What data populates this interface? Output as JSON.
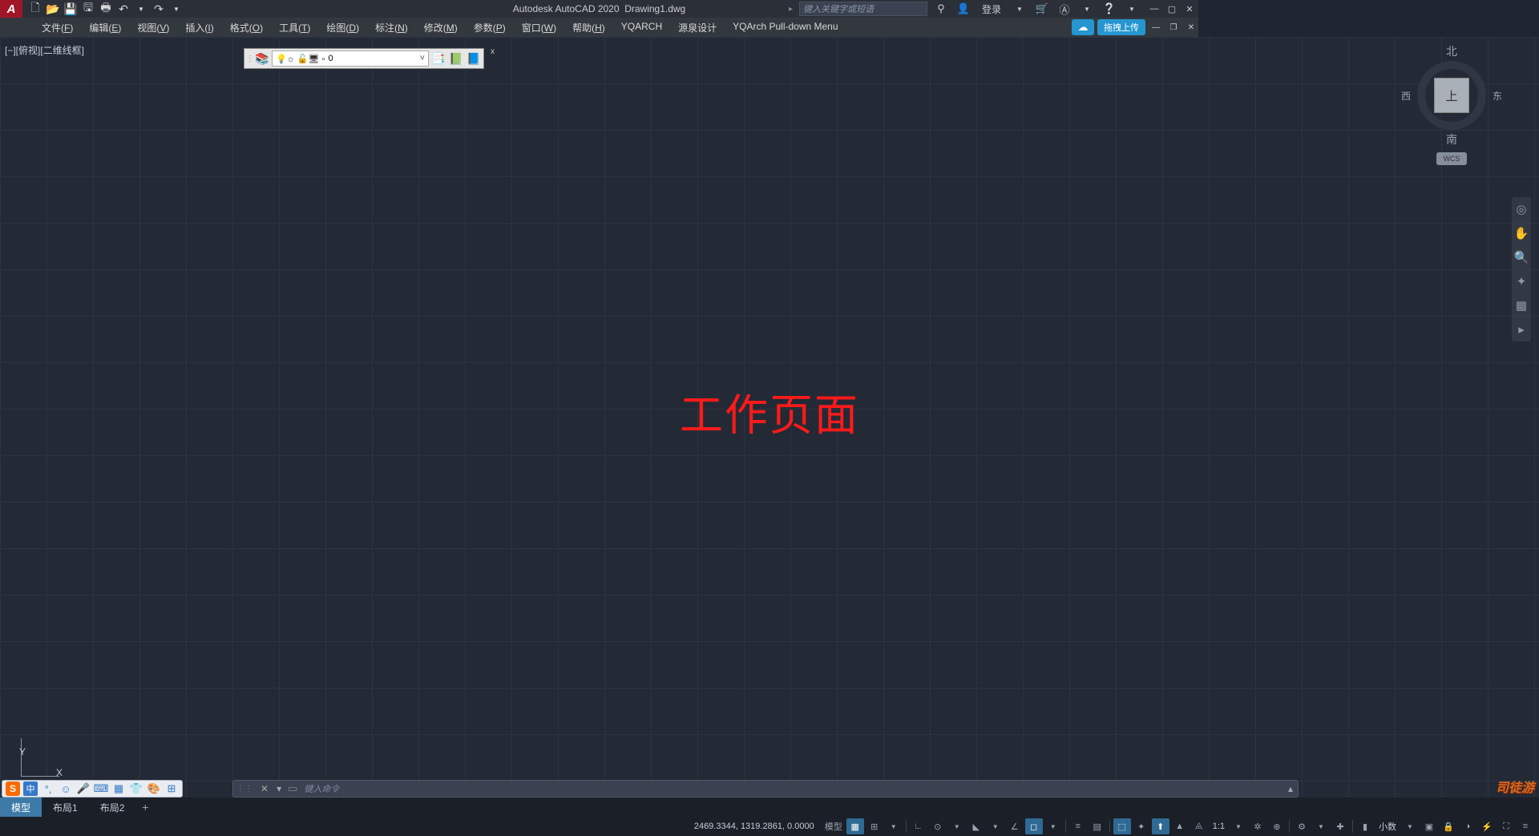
{
  "title": {
    "app": "Autodesk AutoCAD 2020",
    "file": "Drawing1.dwg"
  },
  "search": {
    "placeholder": "键入关键字或短语"
  },
  "login": "登录",
  "upload": "拖拽上传",
  "menubar": [
    {
      "label": "文件",
      "key": "F"
    },
    {
      "label": "编辑",
      "key": "E"
    },
    {
      "label": "视图",
      "key": "V"
    },
    {
      "label": "插入",
      "key": "I"
    },
    {
      "label": "格式",
      "key": "O"
    },
    {
      "label": "工具",
      "key": "T"
    },
    {
      "label": "绘图",
      "key": "D"
    },
    {
      "label": "标注",
      "key": "N"
    },
    {
      "label": "修改",
      "key": "M"
    },
    {
      "label": "参数",
      "key": "P"
    },
    {
      "label": "窗口",
      "key": "W"
    },
    {
      "label": "帮助",
      "key": "H"
    },
    {
      "label": "YQARCH",
      "key": ""
    },
    {
      "label": "源泉设计",
      "key": ""
    },
    {
      "label": "YQArch Pull-down Menu",
      "key": ""
    }
  ],
  "viewport_label": "[−][俯视][二维线框]",
  "layer": {
    "current": "0",
    "icons_left": "☀️💡"
  },
  "center_text": "工作页面",
  "viewcube": {
    "n": "北",
    "s": "南",
    "e": "东",
    "w": "西",
    "top": "上",
    "wcs": "WCS"
  },
  "ucs": {
    "y": "Y",
    "x": "X"
  },
  "command": {
    "placeholder": "键入命令"
  },
  "layout_tabs": [
    "模型",
    "布局1",
    "布局2"
  ],
  "status": {
    "coords": "2469.3344, 1319.2861, 0.0000",
    "model_btn": "模型",
    "scale": "1:1",
    "units": "小数"
  },
  "ime": {
    "cn": "中"
  }
}
